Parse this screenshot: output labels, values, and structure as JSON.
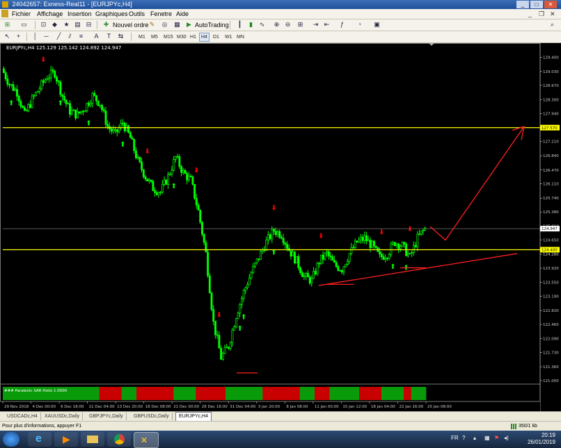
{
  "window": {
    "title": "24042657: Exness-Real11 - [EURJPYc,H4]"
  },
  "menu": [
    "Fichier",
    "Affichage",
    "Insertion",
    "Graphiques",
    "Outils",
    "Fenetre",
    "Aide"
  ],
  "toolbar": {
    "new_order": "Nouvel ordre",
    "autotrading": "AutoTrading"
  },
  "timeframes": [
    "M1",
    "M5",
    "M15",
    "M30",
    "H1",
    "H4",
    "D1",
    "W1",
    "MN"
  ],
  "active_timeframe": "H4",
  "chart": {
    "info": "EURJPYc,H4  125.129 125.142 124.892 124.947",
    "indicator_label": "### Parabolic SAR Histo 1.0000",
    "indicator_scale": [
      "1",
      "0"
    ]
  },
  "chart_data": {
    "type": "candlestick",
    "symbol": "EURJPYc",
    "timeframe": "H4",
    "x_labels": [
      "29 Nov 2018",
      "4 Dec 00:00",
      "6 Dec 16:00",
      "11 Dec 04:00",
      "13 Dec 20:00",
      "18 Dec 08:00",
      "21 Dec 00:00",
      "26 Dec 16:00",
      "31 Dec 04:00",
      "3 Jan 20:00",
      "8 Jan 08:00",
      "11 Jan 00:00",
      "15 Jan 12:00",
      "18 Jan 04:00",
      "22 Jan 16:00",
      "25 Jan 08:00"
    ],
    "y_ticks": [
      "129.400",
      "129.030",
      "128.670",
      "128.300",
      "127.940",
      "127.570",
      "127.210",
      "126.840",
      "126.470",
      "126.110",
      "125.740",
      "125.380",
      "125.010",
      "124.650",
      "124.280",
      "123.920",
      "123.550",
      "123.190",
      "122.820",
      "122.460",
      "122.090",
      "121.730",
      "121.360",
      "121.000"
    ],
    "ylim": [
      121.0,
      129.55
    ],
    "current_price": "124.947",
    "horizontal_lines": [
      {
        "price": "127.570",
        "color": "#ffff00"
      },
      {
        "price": "124.400",
        "color": "#ffff00"
      }
    ],
    "closes": [
      129.1,
      128.7,
      128.5,
      127.9,
      128.3,
      128.6,
      128.9,
      129.0,
      128.4,
      128.0,
      127.9,
      128.1,
      128.4,
      128.2,
      127.6,
      127.4,
      127.7,
      127.3,
      126.7,
      126.3,
      126.0,
      125.9,
      126.3,
      126.8,
      126.4,
      126.2,
      125.4,
      124.3,
      122.5,
      121.6,
      121.9,
      122.7,
      123.3,
      123.8,
      124.2,
      124.6,
      124.9,
      124.8,
      124.4,
      124.1,
      123.7,
      123.6,
      124.1,
      124.3,
      124.0,
      123.9,
      124.3,
      124.6,
      124.7,
      124.5,
      124.2,
      124.3,
      124.6,
      124.5,
      124.2,
      124.7,
      124.95
    ],
    "buy_arrows": [
      8,
      54,
      81,
      113,
      161,
      224,
      226,
      256,
      368,
      381
    ],
    "sell_arrows": [
      38,
      135,
      182,
      204,
      256,
      300,
      358,
      384
    ],
    "sar_histogram": [
      "g",
      "g",
      "g",
      "g",
      "g",
      "g",
      "g",
      "g",
      "g",
      "g",
      "g",
      "g",
      "g",
      "r",
      "r",
      "r",
      "g",
      "g",
      "r",
      "r",
      "r",
      "r",
      "r",
      "g",
      "g",
      "g",
      "r",
      "r",
      "r",
      "r",
      "g",
      "g",
      "g",
      "g",
      "g",
      "r",
      "r",
      "r",
      "r",
      "r",
      "g",
      "g",
      "r",
      "r",
      "g",
      "g",
      "g",
      "g",
      "r",
      "r",
      "r",
      "g",
      "g",
      "g",
      "r",
      "g",
      "g"
    ]
  },
  "colors": {
    "bull": "#00ff00",
    "bear": "#ff0000",
    "level": "#ffff00",
    "trend": "#ff2020"
  },
  "tabs": [
    "USDCADc,H4",
    "XAUUSDc,Daily",
    "GBPJPYc,Daily",
    "GBPUSDc,Daily",
    "EURJPYc,H4"
  ],
  "active_tab": "EURJPYc,H4",
  "status": {
    "help": "Pour plus d'informations, appuyer F1",
    "traffic": "350/1 kb"
  },
  "taskbar": {
    "language": "FR",
    "time": "20:19",
    "date": "26/01/2019"
  }
}
